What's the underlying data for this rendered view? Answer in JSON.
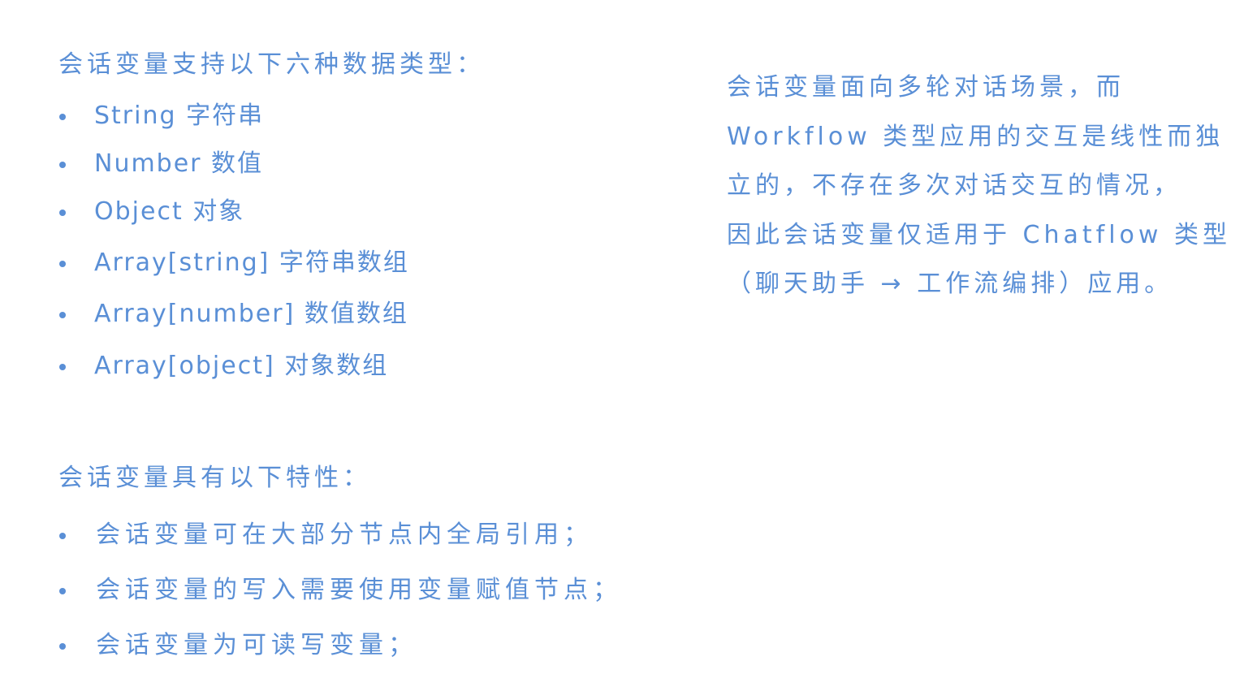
{
  "types_section": {
    "heading": "会话变量支持以下六种数据类型：",
    "items": [
      "String 字符串",
      "Number 数值",
      "Object 对象",
      "Array[string] 字符串数组",
      "Array[number] 数值数组",
      "Array[object] 对象数组"
    ]
  },
  "features_section": {
    "heading": "会话变量具有以下特性：",
    "items": [
      "会话变量可在大部分节点内全局引用；",
      "会话变量的写入需要使用变量赋值节点；",
      "会话变量为可读写变量；"
    ]
  },
  "note": {
    "lines": [
      "会话变量面向多轮对话场景，而",
      "Workflow 类型应用的交互是线性而独",
      "立的，不存在多次对话交互的情况，",
      "因此会话变量仅适用于 Chatflow 类型",
      "（聊天助手 → 工作流编排）应用。"
    ]
  }
}
